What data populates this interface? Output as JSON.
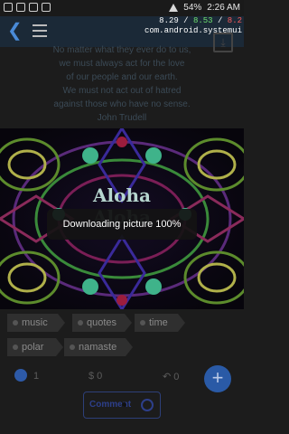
{
  "status_bar": {
    "battery": "54%",
    "time": "2:26 AM"
  },
  "overlay": {
    "cpu_a": "8.29",
    "cpu_b": "8.53",
    "cpu_c": "8.2",
    "process": "com.android.systemui"
  },
  "quote": {
    "lines": [
      "No matter what they ever do to us,",
      "we must always act for the love",
      "of our people and our earth.",
      "We must not act out of hatred",
      "against those who have no sense.",
      "John Trudell"
    ]
  },
  "image": {
    "text": "Aloha"
  },
  "toast": {
    "message": "Downloading picture 100%"
  },
  "tags": [
    "music",
    "quotes",
    "time",
    "polar",
    "namaste"
  ],
  "stats": {
    "likes": "1",
    "tips": "$ 0",
    "reposts": "0"
  },
  "actions": {
    "comment_label": "Comment",
    "fab": "+"
  }
}
